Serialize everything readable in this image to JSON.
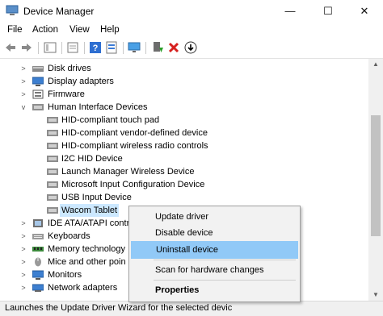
{
  "window": {
    "title": "Device Manager",
    "controls": {
      "minimize": "—",
      "maximize": "☐",
      "close": "✕"
    }
  },
  "menu": [
    "File",
    "Action",
    "View",
    "Help"
  ],
  "toolbar": {
    "icons": [
      "back-icon",
      "forward-icon",
      "properties-icon",
      "refresh-icon",
      "help-icon",
      "computer-icon",
      "update-driver-icon",
      "uninstall-icon",
      "download-icon"
    ]
  },
  "tree": {
    "disk_drives": "Disk drives",
    "display_adapters": "Display adapters",
    "firmware": "Firmware",
    "hid": "Human Interface Devices",
    "hid_children": [
      "HID-compliant touch pad",
      "HID-compliant vendor-defined device",
      "HID-compliant wireless radio controls",
      "I2C HID Device",
      "Launch Manager Wireless Device",
      "Microsoft Input Configuration Device",
      "USB Input Device",
      "Wacom Tablet"
    ],
    "ide": "IDE ATA/ATAPI contro",
    "keyboards": "Keyboards",
    "memory": "Memory technology",
    "mice": "Mice and other poin",
    "monitors": "Monitors",
    "network": "Network adapters"
  },
  "context_menu": {
    "update": "Update driver",
    "disable": "Disable device",
    "uninstall": "Uninstall device",
    "scan": "Scan for hardware changes",
    "properties": "Properties"
  },
  "status": "Launches the Update Driver Wizard for the selected devic"
}
